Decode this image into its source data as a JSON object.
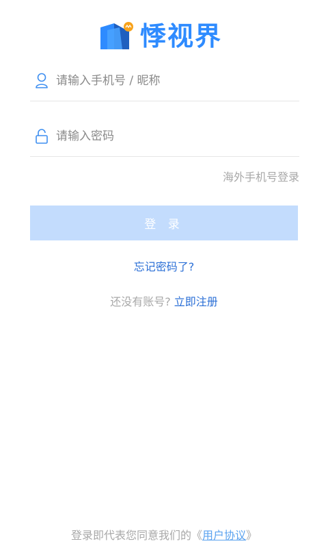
{
  "brand": {
    "name": "悸视界",
    "primary_color": "#2e8bff",
    "accent_color": "#f7a21b",
    "mark_icon": "brand-logo-mark"
  },
  "login_form": {
    "account_placeholder": "请输入手机号 / 昵称",
    "account_icon": "user-icon",
    "password_placeholder": "请输入密码",
    "password_icon": "lock-icon",
    "overseas_login_label": "海外手机号登录",
    "submit_label": "登 录",
    "submit_color": "#c3dcfd"
  },
  "links": {
    "forgot_password": "忘记密码了?",
    "no_account_text": "还没有账号?",
    "register_now": "立即注册",
    "link_color": "#2b6fd6"
  },
  "footer": {
    "agreement_prefix": "登录即代表您同意我们的《",
    "agreement_link": "用户协议",
    "agreement_suffix": "》"
  }
}
